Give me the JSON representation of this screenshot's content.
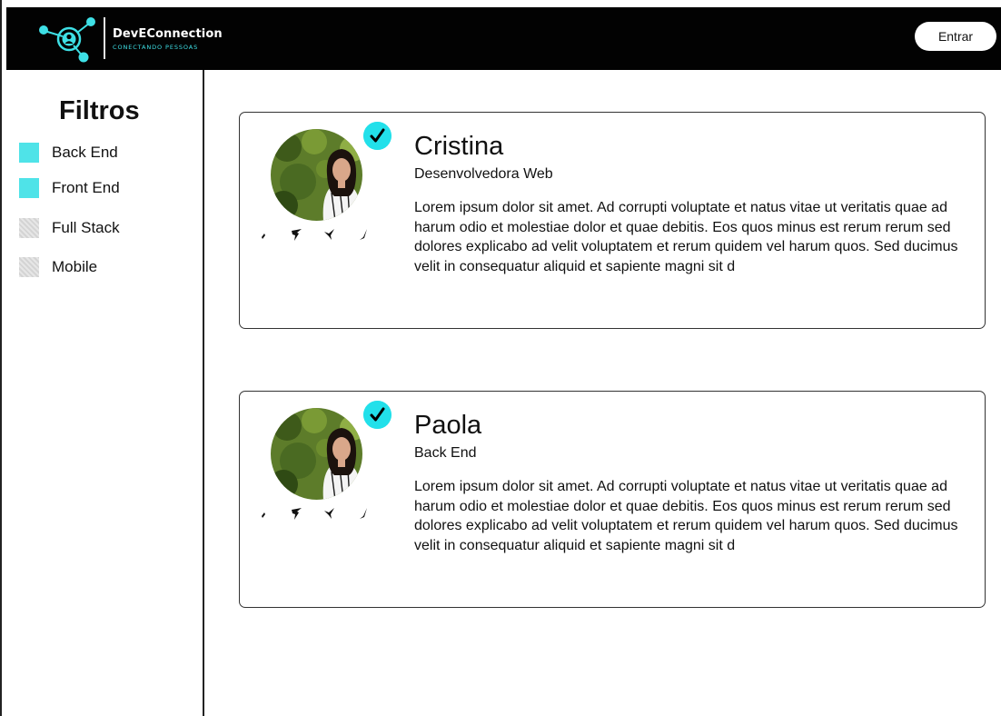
{
  "header": {
    "brand_name": "DevEConnection",
    "brand_tagline": "CONECTANDO PESSOAS",
    "login_label": "Entrar",
    "colors": {
      "background": "#020202",
      "accent": "#3ee0e6"
    }
  },
  "sidebar": {
    "title": "Filtros",
    "filters": [
      {
        "label": "Back End",
        "checked": true
      },
      {
        "label": "Front End",
        "checked": true
      },
      {
        "label": "Full Stack",
        "checked": false
      },
      {
        "label": "Mobile",
        "checked": false
      }
    ],
    "colors": {
      "checked": "#4fe3e8"
    }
  },
  "profiles": [
    {
      "name": "Cristina",
      "role": "Desenvolvedora Web",
      "bio": "Lorem ipsum dolor sit amet. Ad corrupti voluptate et natus vitae ut veritatis quae ad harum odio et molestiae dolor et quae debitis. Eos quos minus est rerum rerum sed dolores explicabo ad velit voluptatem et rerum quidem vel harum quos. Sed ducimus velit in consequatur aliquid et sapiente magni sit d",
      "verified": true,
      "social_icons": [
        "social-icon-1",
        "social-icon-2",
        "social-icon-3",
        "social-icon-4"
      ]
    },
    {
      "name": "Paola",
      "role": "Back End",
      "bio": "Lorem ipsum dolor sit amet. Ad corrupti voluptate et natus vitae ut veritatis quae ad harum odio et molestiae dolor et quae debitis. Eos quos minus est rerum rerum sed dolores explicabo ad velit voluptatem et rerum quidem vel harum quos. Sed ducimus velit in consequatur aliquid et sapiente magni sit d",
      "verified": true,
      "social_icons": [
        "social-icon-1",
        "social-icon-2",
        "social-icon-3",
        "social-icon-4"
      ]
    }
  ]
}
